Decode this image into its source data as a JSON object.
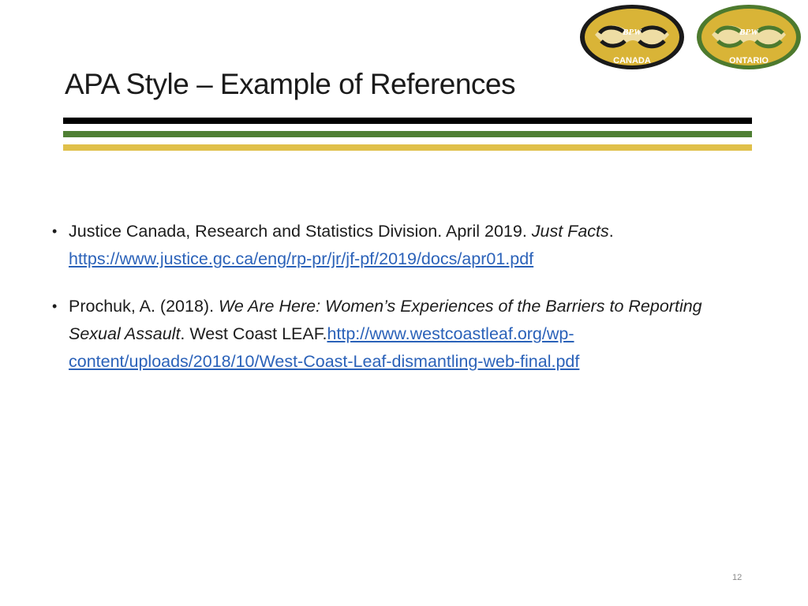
{
  "logos": {
    "canada": {
      "top_text": "BPW",
      "bottom_text": "CANADA"
    },
    "ontario": {
      "top_text": "BPW",
      "bottom_text": "ONTARIO"
    }
  },
  "title": "APA Style – Example of References",
  "references": [
    {
      "bullet": "•",
      "text_before": "Justice Canada, Research and Statistics Division. April 2019. ",
      "italic": "Just Facts",
      "text_after": ". ",
      "link": "https://www.justice.gc.ca/eng/rp-pr/jr/jf-pf/2019/docs/apr01.pdf"
    },
    {
      "bullet": "•",
      "text_before": "Prochuk, A. (2018). ",
      "italic": "We Are Here: Women’s Experiences of the Barriers to Reporting Sexual Assault",
      "text_after": ". West Coast LEAF.",
      "link": "http://www.westcoastleaf.org/wp-content/uploads/2018/10/West-Coast-Leaf-dismantling-web-final.pdf"
    }
  ],
  "page_number": "12",
  "colors": {
    "black_stripe": "#000000",
    "green_stripe": "#4f7f34",
    "gold_stripe": "#e0c04a",
    "link": "#2b62b9"
  }
}
